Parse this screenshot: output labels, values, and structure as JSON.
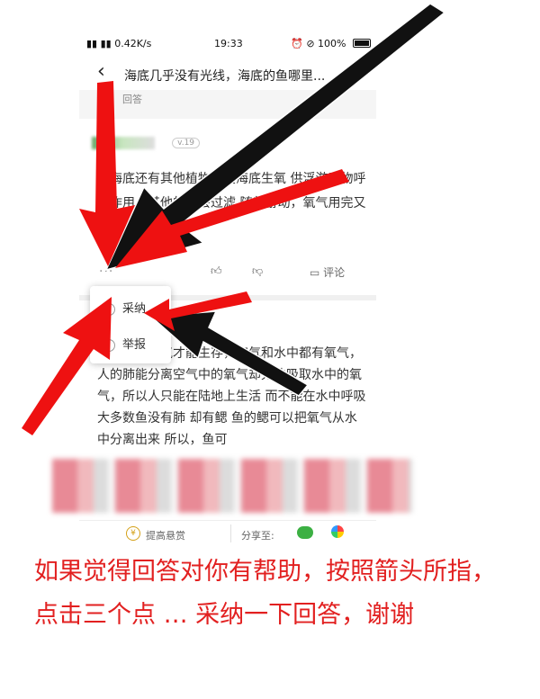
{
  "status_bar": {
    "signal": "▮▮ ▮▮ 0.42K/s",
    "time": "19:33",
    "icons": "⏰ ⊘",
    "battery": "100%"
  },
  "nav": {
    "back_icon": "chevron-left-icon",
    "title": "海底几乎没有光线，海底的鱼哪里...",
    "menu": "⋮"
  },
  "section_label": "回答",
  "answer1": {
    "user_level": "v.19",
    "text": "为海底还有其他植物会在海底生氧 供浮游动物呼吸作用，其他的鳃会过滤 随着游动，氧气用完又会 生氧气"
  },
  "actions": {
    "more": "···",
    "like_icon": "thumbs-up-icon",
    "dislike_icon": "thumbs-down-icon",
    "comment_label": "评论"
  },
  "popup": {
    "accept_label": "采纳",
    "report_label": "举报"
  },
  "answer2": {
    "text": "必须呼吸氧气才能生存，空气和水中都有氧气，人的肺能分离空气中的氧气却无法吸取水中的氧气，所以人只能在陆地上生活 而不能在水中呼吸大多数鱼没有肺 却有鳃 鱼的鳃可以把氧气从水中分离出来 所以，鱼可"
  },
  "bottom_bar": {
    "raise_label": "提高悬赏",
    "share_label": "分享至:",
    "coin": "¥"
  },
  "instruction": "如果觉得回答对你有帮助，按照箭头所指，点击三个点 … 采纳一下回答，谢谢",
  "colors": {
    "arrow_red": "#ee1111",
    "arrow_black": "#111111",
    "instruction_red": "#e22020"
  }
}
